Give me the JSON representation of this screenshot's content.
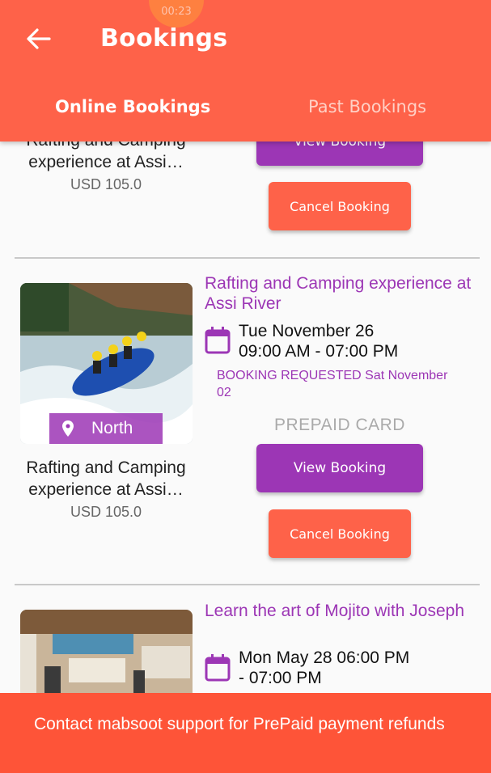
{
  "recording": {
    "timer": "00:23"
  },
  "header": {
    "title": "Bookings",
    "tabs": [
      {
        "label": "Online Bookings",
        "active": true
      },
      {
        "label": "Past Bookings",
        "active": false
      }
    ]
  },
  "bookings": [
    {
      "name": "Rafting and Camping experience at Assi…",
      "price": "USD 105.0",
      "view_label": "View Booking",
      "cancel_label": "Cancel Booking"
    },
    {
      "name": "Rafting and Camping experience at Assi…",
      "price": "USD 105.0",
      "location": "North",
      "title": "Rafting and Camping experience at Assi River",
      "date_line1": "Tue November 26",
      "date_line2": "09:00 AM - 07:00 PM",
      "status": "BOOKING REQUESTED  Sat November 02",
      "payment": "PREPAID CARD",
      "view_label": "View Booking",
      "cancel_label": "Cancel Booking"
    },
    {
      "title": "Learn the art of Mojito with Joseph",
      "date_line1": "Mon May 28  06:00 PM",
      "date_line2": "- 07:00 PM"
    }
  ],
  "snackbar": {
    "message": "Contact mabsoot support for PrePaid payment refunds"
  },
  "colors": {
    "primary": "#fe6249",
    "accent": "#9c36b5"
  },
  "icons": {
    "back": "arrow-left-icon",
    "calendar": "calendar-icon",
    "location": "location-pin-icon"
  }
}
